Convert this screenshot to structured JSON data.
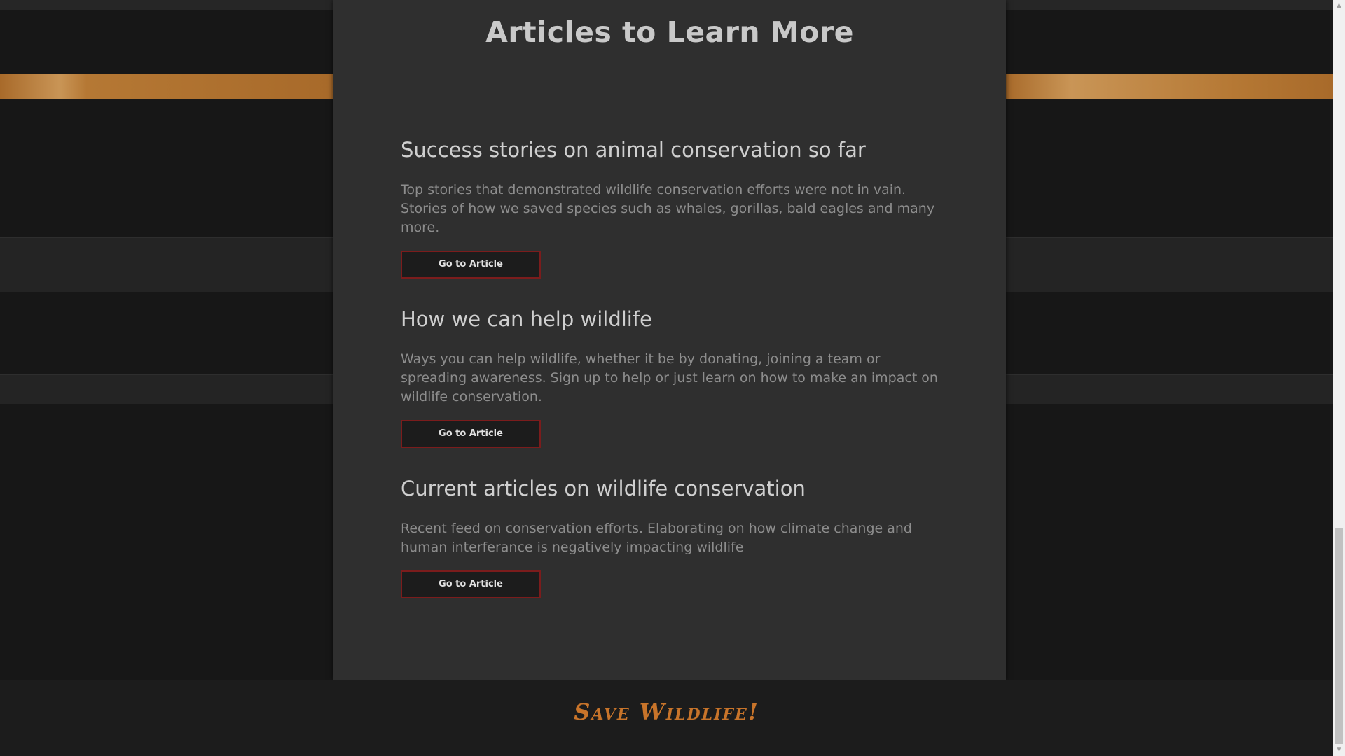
{
  "section": {
    "title": "Articles to Learn More"
  },
  "articles": [
    {
      "heading": "Success stories on animal conservation so far",
      "description": "Top stories that demonstrated wildlife conservation efforts were not in vain. Stories of how we saved species such as whales, gorillas, bald eagles and many more.",
      "button_label": "Go to Article"
    },
    {
      "heading": "How we can help wildlife",
      "description": "Ways you can help wildlife, whether it be by donating, joining a team or spreading awareness. Sign up to help or just learn on how to make an impact on wildlife conservation.",
      "button_label": "Go to Article"
    },
    {
      "heading": "Current articles on wildlife conservation",
      "description": "Recent feed on conservation efforts. Elaborating on how climate change and human interferance is negatively impacting wildlife",
      "button_label": "Go to Article"
    }
  ],
  "footer": {
    "title": "Save Wildlife!"
  },
  "scrollbar": {
    "up_icon": "scroll-up-arrow-icon",
    "down_icon": "scroll-down-arrow-icon"
  },
  "colors": {
    "page_background": "#171717",
    "panel_background": "#2f2f2f",
    "accent_gold": "#c99556",
    "footer_title": "#c8742a",
    "button_border": "#7b1c1c"
  }
}
